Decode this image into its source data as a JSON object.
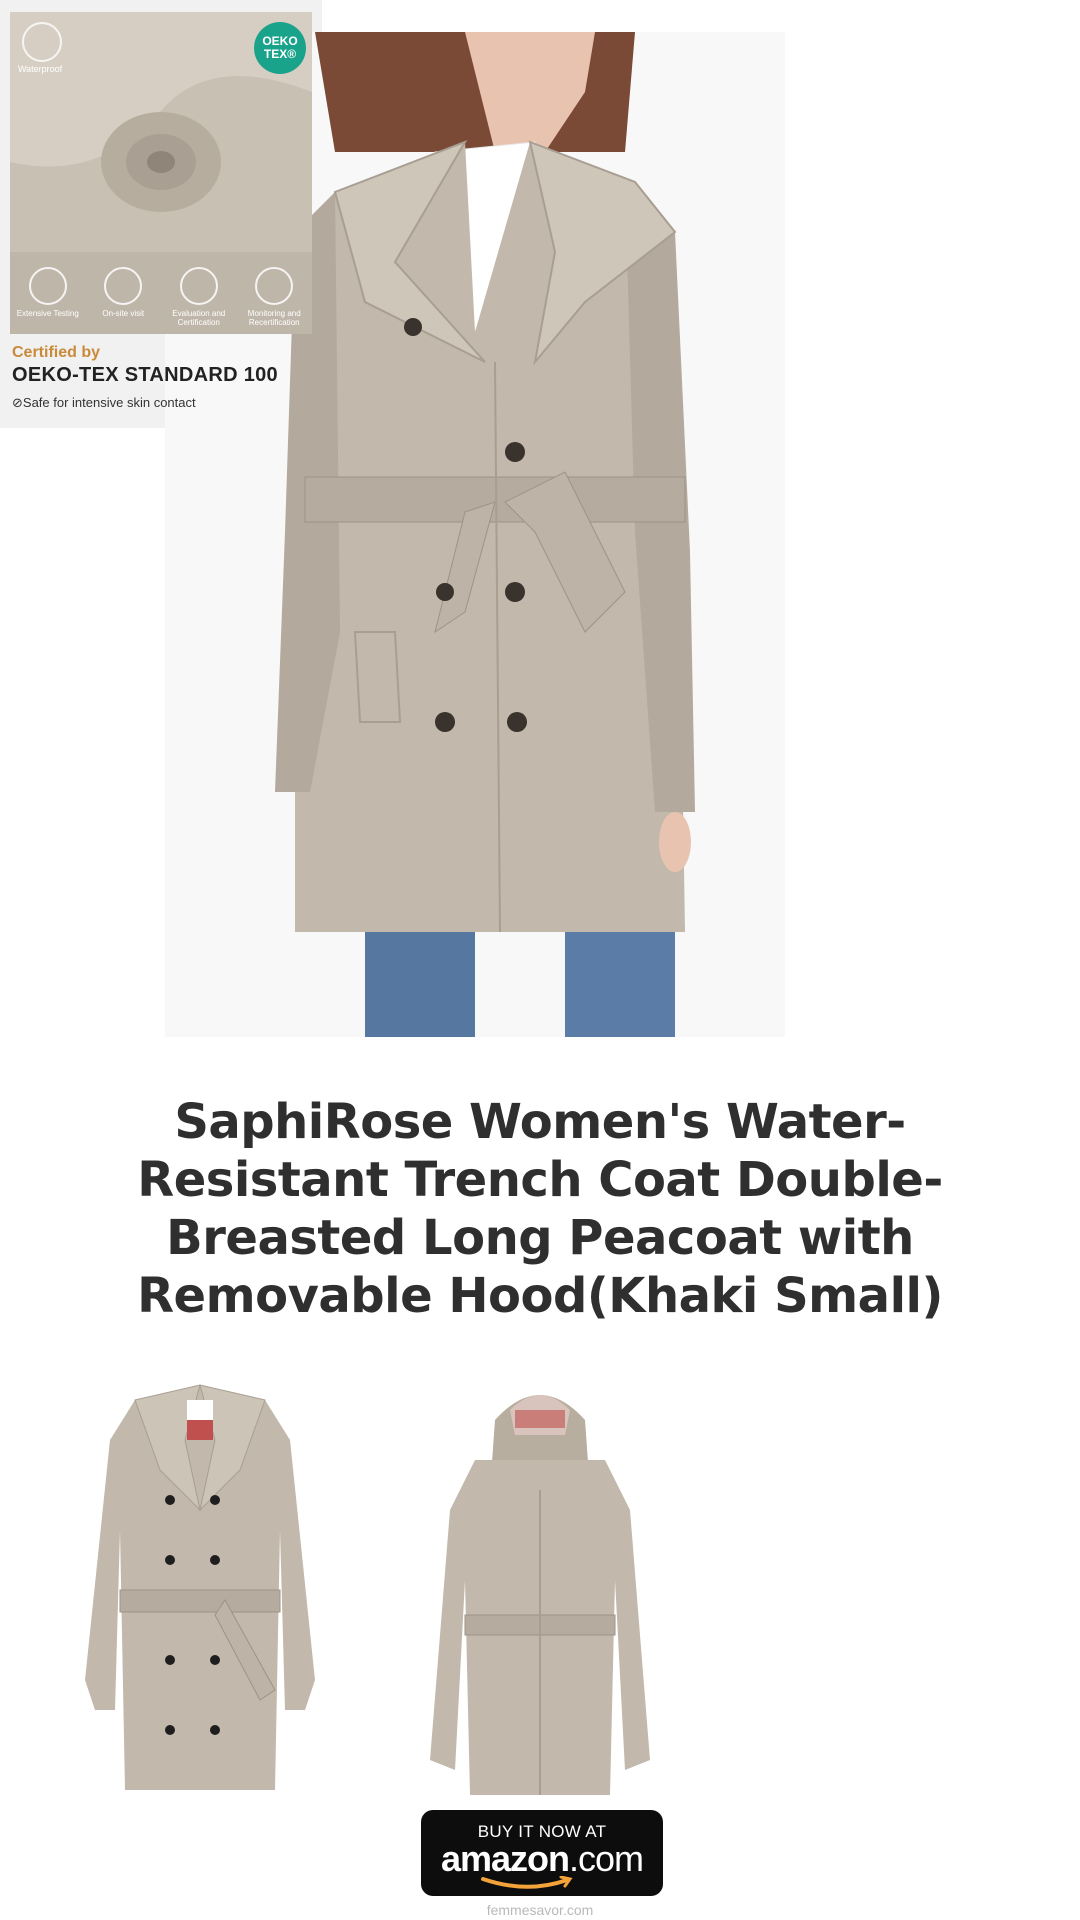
{
  "product": {
    "title": "SaphiRose Women's Water-Resistant Trench Coat Double-Breasted Long Peacoat with Removable Hood(Khaki Small)"
  },
  "images": {
    "hero": "model-wearing-khaki-trench-coat",
    "thumb_front": "trench-coat-front-view",
    "thumb_back": "trench-coat-back-view-hood",
    "thumb_cert": "oeko-tex-certification-fabric"
  },
  "certification": {
    "badge": "OEKO TEX®",
    "waterproof_label": "Waterproof",
    "steps": [
      "Extensive Testing",
      "On-site visit",
      "Evaluation and Certification",
      "Monitoring and Recertification"
    ],
    "certified_by": "Certified by",
    "standard": "OEKO-TEX STANDARD 100",
    "safe_text": "Safe for intensive skin contact"
  },
  "buy_button": {
    "top_text": "BUY IT NOW AT",
    "brand": "amazon",
    "tld": ".com"
  },
  "footer": {
    "site": "femmesavor.com"
  },
  "colors": {
    "khaki": "#c2b8ab",
    "oeko_green": "#1aa38b",
    "button_bg": "#0d0d0d",
    "amazon_smile": "#f3a33a"
  }
}
